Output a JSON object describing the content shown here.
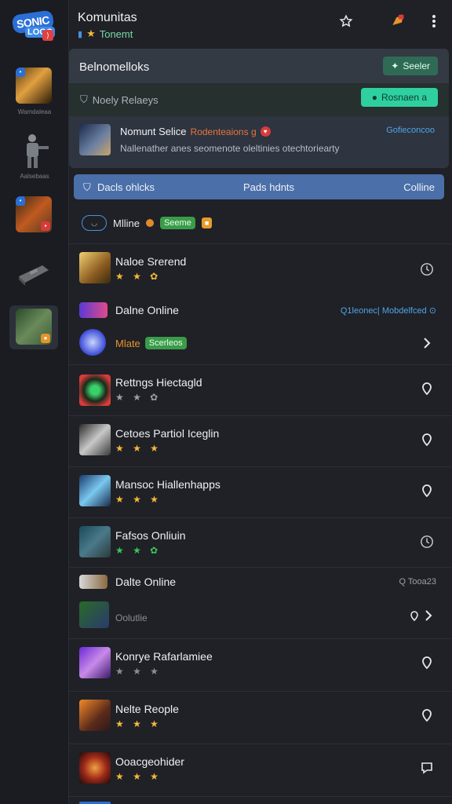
{
  "header": {
    "title": "Komunitas",
    "subtitle": "Tonemt",
    "icons": [
      "star-outline-icon",
      "notification-icon",
      "more-vertical-icon"
    ]
  },
  "logo": {
    "line1": "SONIC",
    "line2": "LOGO"
  },
  "rail": {
    "caption1": "Wamdaleaa",
    "caption2": "Aalsebaas"
  },
  "card": {
    "title": "Belnomelloks",
    "button1": "Seeler",
    "row2_label": "Noely Relaeys",
    "button2": "Rosnaen a",
    "item_name": "Nomunt Selice",
    "item_tag": "Rodenteaions g",
    "item_desc": "Nallenather anes seomenote oleltinies otechtoriearty",
    "item_link": "Gofieconcoo"
  },
  "bluebar": {
    "left": "Dacls ohlcks",
    "center": "Pads hdnts",
    "right": "Colline"
  },
  "filter": {
    "label": "Mlline",
    "pill": "Seeme"
  },
  "rows": [
    {
      "name": "Naloe Srerend",
      "stars": "★ ★ ✿",
      "icon": "clock-icon"
    },
    {
      "name": "Rettngs Hiectagld",
      "stars": "★ ★ ✿",
      "icon": "pin-icon"
    },
    {
      "name": "Cetoes Partiol Iceglin",
      "stars": "★ ★ ★",
      "icon": "pin-icon"
    },
    {
      "name": "Mansoc Hiallenhapps",
      "stars": "★ ★ ★",
      "icon": "pin-icon"
    },
    {
      "name": "Fafsos Onliuin",
      "stars": "★ ★ ✿",
      "icon": "clock-icon"
    },
    {
      "name": "Konrye Rafarlamiee",
      "stars": "★ ★ ★",
      "icon": "pin-icon"
    },
    {
      "name": "Nelte Reople",
      "stars": "★ ★ ★",
      "icon": "pin-icon"
    },
    {
      "name": "Ooacgeohider",
      "stars": "★ ★ ★",
      "icon": "chat-icon"
    }
  ],
  "sections": {
    "s1": {
      "label": "Dalne Online",
      "right": "Q1leonec| Mobdelfced ⊙"
    },
    "s1_sub": {
      "label": "Mlate",
      "pill": "Scerleos"
    },
    "s2": {
      "label": "Dalte Online",
      "right": "Q Tooa23"
    },
    "s2_sub": {
      "label": "Oolutlie"
    }
  }
}
